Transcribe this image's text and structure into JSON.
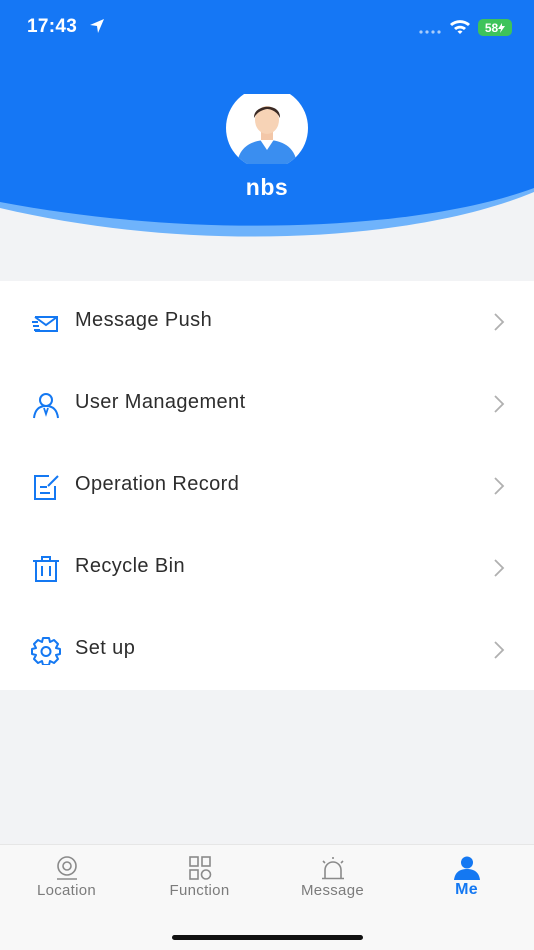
{
  "status_bar": {
    "time": "17:43",
    "battery": "58"
  },
  "profile": {
    "username": "nbs"
  },
  "menu": {
    "items": [
      {
        "label": "Message Push",
        "icon": "message-push-icon"
      },
      {
        "label": "User Management",
        "icon": "user-icon"
      },
      {
        "label": "Operation Record",
        "icon": "edit-record-icon"
      },
      {
        "label": "Recycle Bin",
        "icon": "trash-icon"
      },
      {
        "label": "Set up",
        "icon": "gear-icon"
      }
    ]
  },
  "tabbar": {
    "tabs": [
      {
        "label": "Location",
        "icon": "camera-location-icon",
        "active": false
      },
      {
        "label": "Function",
        "icon": "grid-icon",
        "active": false
      },
      {
        "label": "Message",
        "icon": "alarm-icon",
        "active": false
      },
      {
        "label": "Me",
        "icon": "person-icon",
        "active": true
      }
    ]
  },
  "colors": {
    "accent": "#1478f2",
    "header_blue": "#1577f5",
    "wave_light": "#6fb3fb",
    "background": "#f2f3f5"
  }
}
